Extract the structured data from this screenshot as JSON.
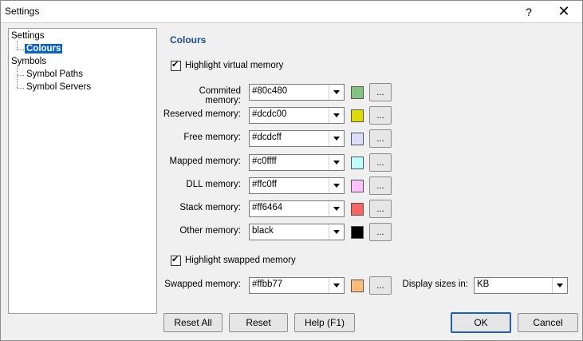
{
  "window": {
    "title": "Settings",
    "help_glyph": "?",
    "close_glyph": "✕"
  },
  "tree": {
    "settings": "Settings",
    "colours": "Colours",
    "symbols": "Symbols",
    "symbol_paths": "Symbol Paths",
    "symbol_servers": "Symbol Servers"
  },
  "section_title": "Colours",
  "highlight_virtual": {
    "label": "Highlight virtual memory",
    "checked": true
  },
  "memory_rows": [
    {
      "label": "Commited memory:",
      "value": "#80c480",
      "color": "#80c480"
    },
    {
      "label": "Reserved memory:",
      "value": "#dcdc00",
      "color": "#dcdc00"
    },
    {
      "label": "Free memory:",
      "value": "#dcdcff",
      "color": "#dcdcff"
    },
    {
      "label": "Mapped memory:",
      "value": "#c0ffff",
      "color": "#c0ffff"
    },
    {
      "label": "DLL memory:",
      "value": "#ffc0ff",
      "color": "#ffc0ff"
    },
    {
      "label": "Stack memory:",
      "value": "#ff6464",
      "color": "#ff6464"
    },
    {
      "label": "Other memory:",
      "value": "black",
      "color": "#000000"
    }
  ],
  "highlight_swapped": {
    "label": "Highlight swapped memory",
    "checked": true
  },
  "swapped": {
    "label": "Swapped memory:",
    "value": "#ffbb77",
    "color": "#ffbb77"
  },
  "display_sizes": {
    "label": "Display sizes in:",
    "value": "KB"
  },
  "ellipsis": "...",
  "buttons": {
    "reset_all": "Reset All",
    "reset": "Reset",
    "help": "Help (F1)",
    "ok": "OK",
    "cancel": "Cancel"
  }
}
